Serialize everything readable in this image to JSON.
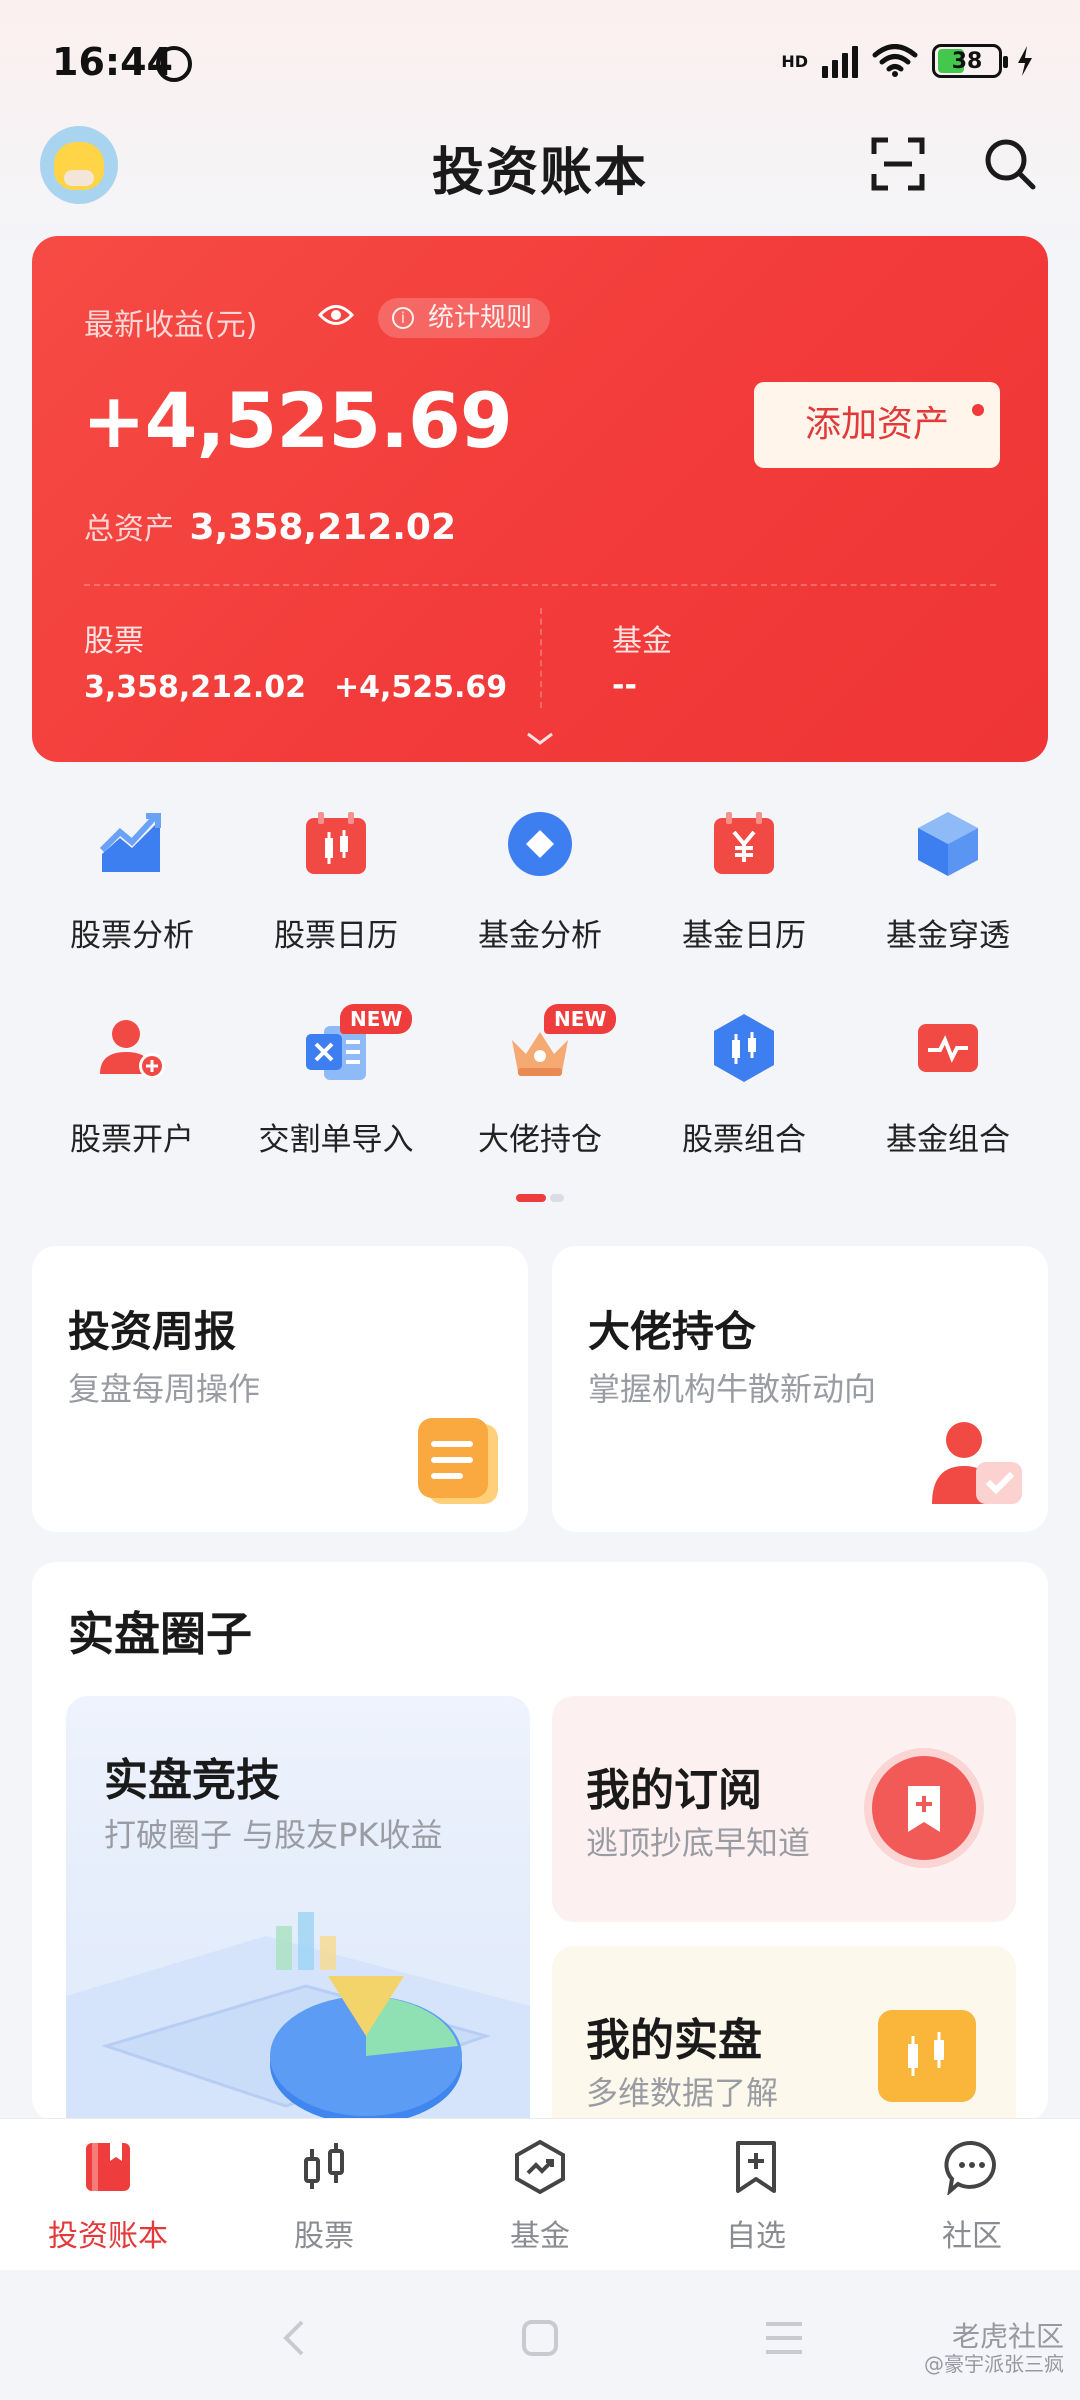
{
  "status": {
    "time": "16:44",
    "network": "HD",
    "battery": "38"
  },
  "header": {
    "title": "投资账本"
  },
  "summary": {
    "earnings_label": "最新收益(元)",
    "rule_label": "统计规则",
    "earnings_value": "+4,525.69",
    "add_asset_label": "添加资产",
    "total_label": "总资产",
    "total_value": "3,358,212.02",
    "stocks_label": "股票",
    "stocks_value": "3,358,212.02",
    "stocks_gain": "+4,525.69",
    "fund_label": "基金",
    "fund_value": "--"
  },
  "grid": [
    {
      "label": "股票分析",
      "icon": "trend-chart-icon"
    },
    {
      "label": "股票日历",
      "icon": "stock-calendar-icon"
    },
    {
      "label": "基金分析",
      "icon": "fund-analysis-icon"
    },
    {
      "label": "基金日历",
      "icon": "fund-calendar-icon"
    },
    {
      "label": "基金穿透",
      "icon": "cube-icon"
    },
    {
      "label": "股票开户",
      "icon": "user-add-icon"
    },
    {
      "label": "交割单导入",
      "icon": "excel-import-icon",
      "badge": "NEW"
    },
    {
      "label": "大佬持仓",
      "icon": "crown-icon",
      "badge": "NEW"
    },
    {
      "label": "股票组合",
      "icon": "hexagon-candle-icon"
    },
    {
      "label": "基金组合",
      "icon": "fund-portfolio-icon"
    }
  ],
  "features": {
    "weekly": {
      "title": "投资周报",
      "subtitle": "复盘每周操作"
    },
    "holders": {
      "title": "大佬持仓",
      "subtitle": "掌握机构牛散新动向"
    }
  },
  "circle": {
    "title": "实盘圈子",
    "contest": {
      "title": "实盘竞技",
      "subtitle": "打破圈子 与股友PK收益"
    },
    "subscribe": {
      "title": "我的订阅",
      "subtitle": "逃顶抄底早知道"
    },
    "portfolio": {
      "title": "我的实盘",
      "subtitle": "多维数据了解"
    }
  },
  "tabs": [
    {
      "label": "投资账本",
      "active": true
    },
    {
      "label": "股票"
    },
    {
      "label": "基金"
    },
    {
      "label": "自选"
    },
    {
      "label": "社区"
    }
  ],
  "watermark": {
    "brand": "老虎社区",
    "user": "@豪宇派张三疯"
  },
  "colors": {
    "accent": "#ef3c3c",
    "blue": "#3d7ef0"
  }
}
